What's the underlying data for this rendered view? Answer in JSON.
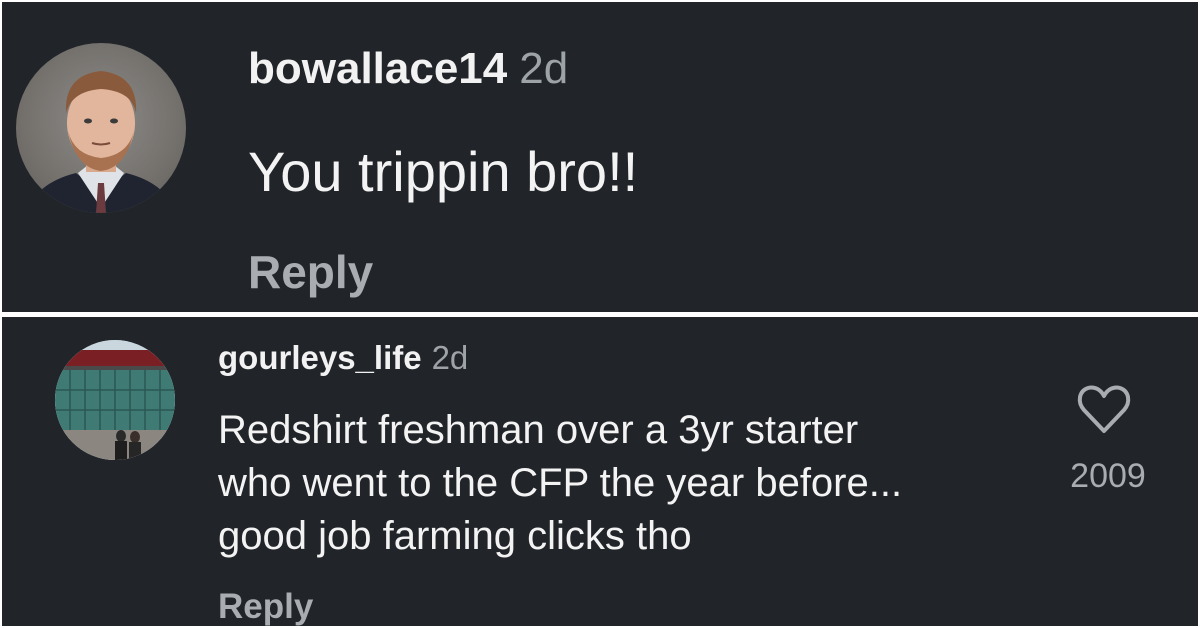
{
  "comments": [
    {
      "username": "bowallace14",
      "time": "2d",
      "text": "You trippin bro!!",
      "reply_label": "Reply"
    },
    {
      "username": "gourleys_life",
      "time": "2d",
      "text_lines": [
        "Redshirt freshman over a 3yr starter",
        "who went to the CFP the year before...",
        "good job farming clicks tho"
      ],
      "reply_label": "Reply",
      "likes": "2009",
      "like_icon": "heart-icon"
    }
  ],
  "colors": {
    "background": "#212529",
    "username": "#f2f2f2",
    "secondary_text": "#9ea3a8",
    "reply": "#a9adb1"
  }
}
